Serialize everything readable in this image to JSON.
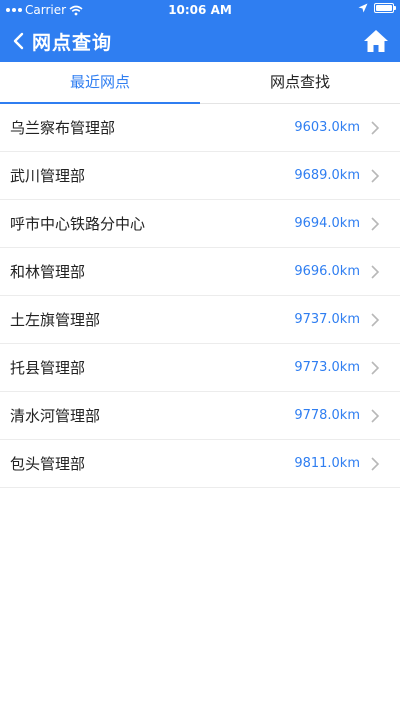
{
  "status_bar": {
    "carrier": "Carrier",
    "time": "10:06 AM",
    "icons": [
      "signal-dots-icon",
      "wifi-icon",
      "location-arrow-icon",
      "battery-icon"
    ]
  },
  "nav": {
    "title": "网点查询",
    "back_icon": "chevron-left-icon",
    "home_icon": "home-icon"
  },
  "tabs": [
    {
      "label": "最近网点",
      "active": true
    },
    {
      "label": "网点查找",
      "active": false
    }
  ],
  "list": [
    {
      "name": "乌兰察布管理部",
      "distance": "9603.0km"
    },
    {
      "name": "武川管理部",
      "distance": "9689.0km"
    },
    {
      "name": "呼市中心铁路分中心",
      "distance": "9694.0km"
    },
    {
      "name": "和林管理部",
      "distance": "9696.0km"
    },
    {
      "name": "土左旗管理部",
      "distance": "9737.0km"
    },
    {
      "name": "托县管理部",
      "distance": "9773.0km"
    },
    {
      "name": "清水河管理部",
      "distance": "9778.0km"
    },
    {
      "name": "包头管理部",
      "distance": "9811.0km"
    }
  ],
  "colors": {
    "primary": "#2f7ef1",
    "text": "#222222",
    "chevron": "#b8b8b8",
    "divider": "#ececec"
  }
}
